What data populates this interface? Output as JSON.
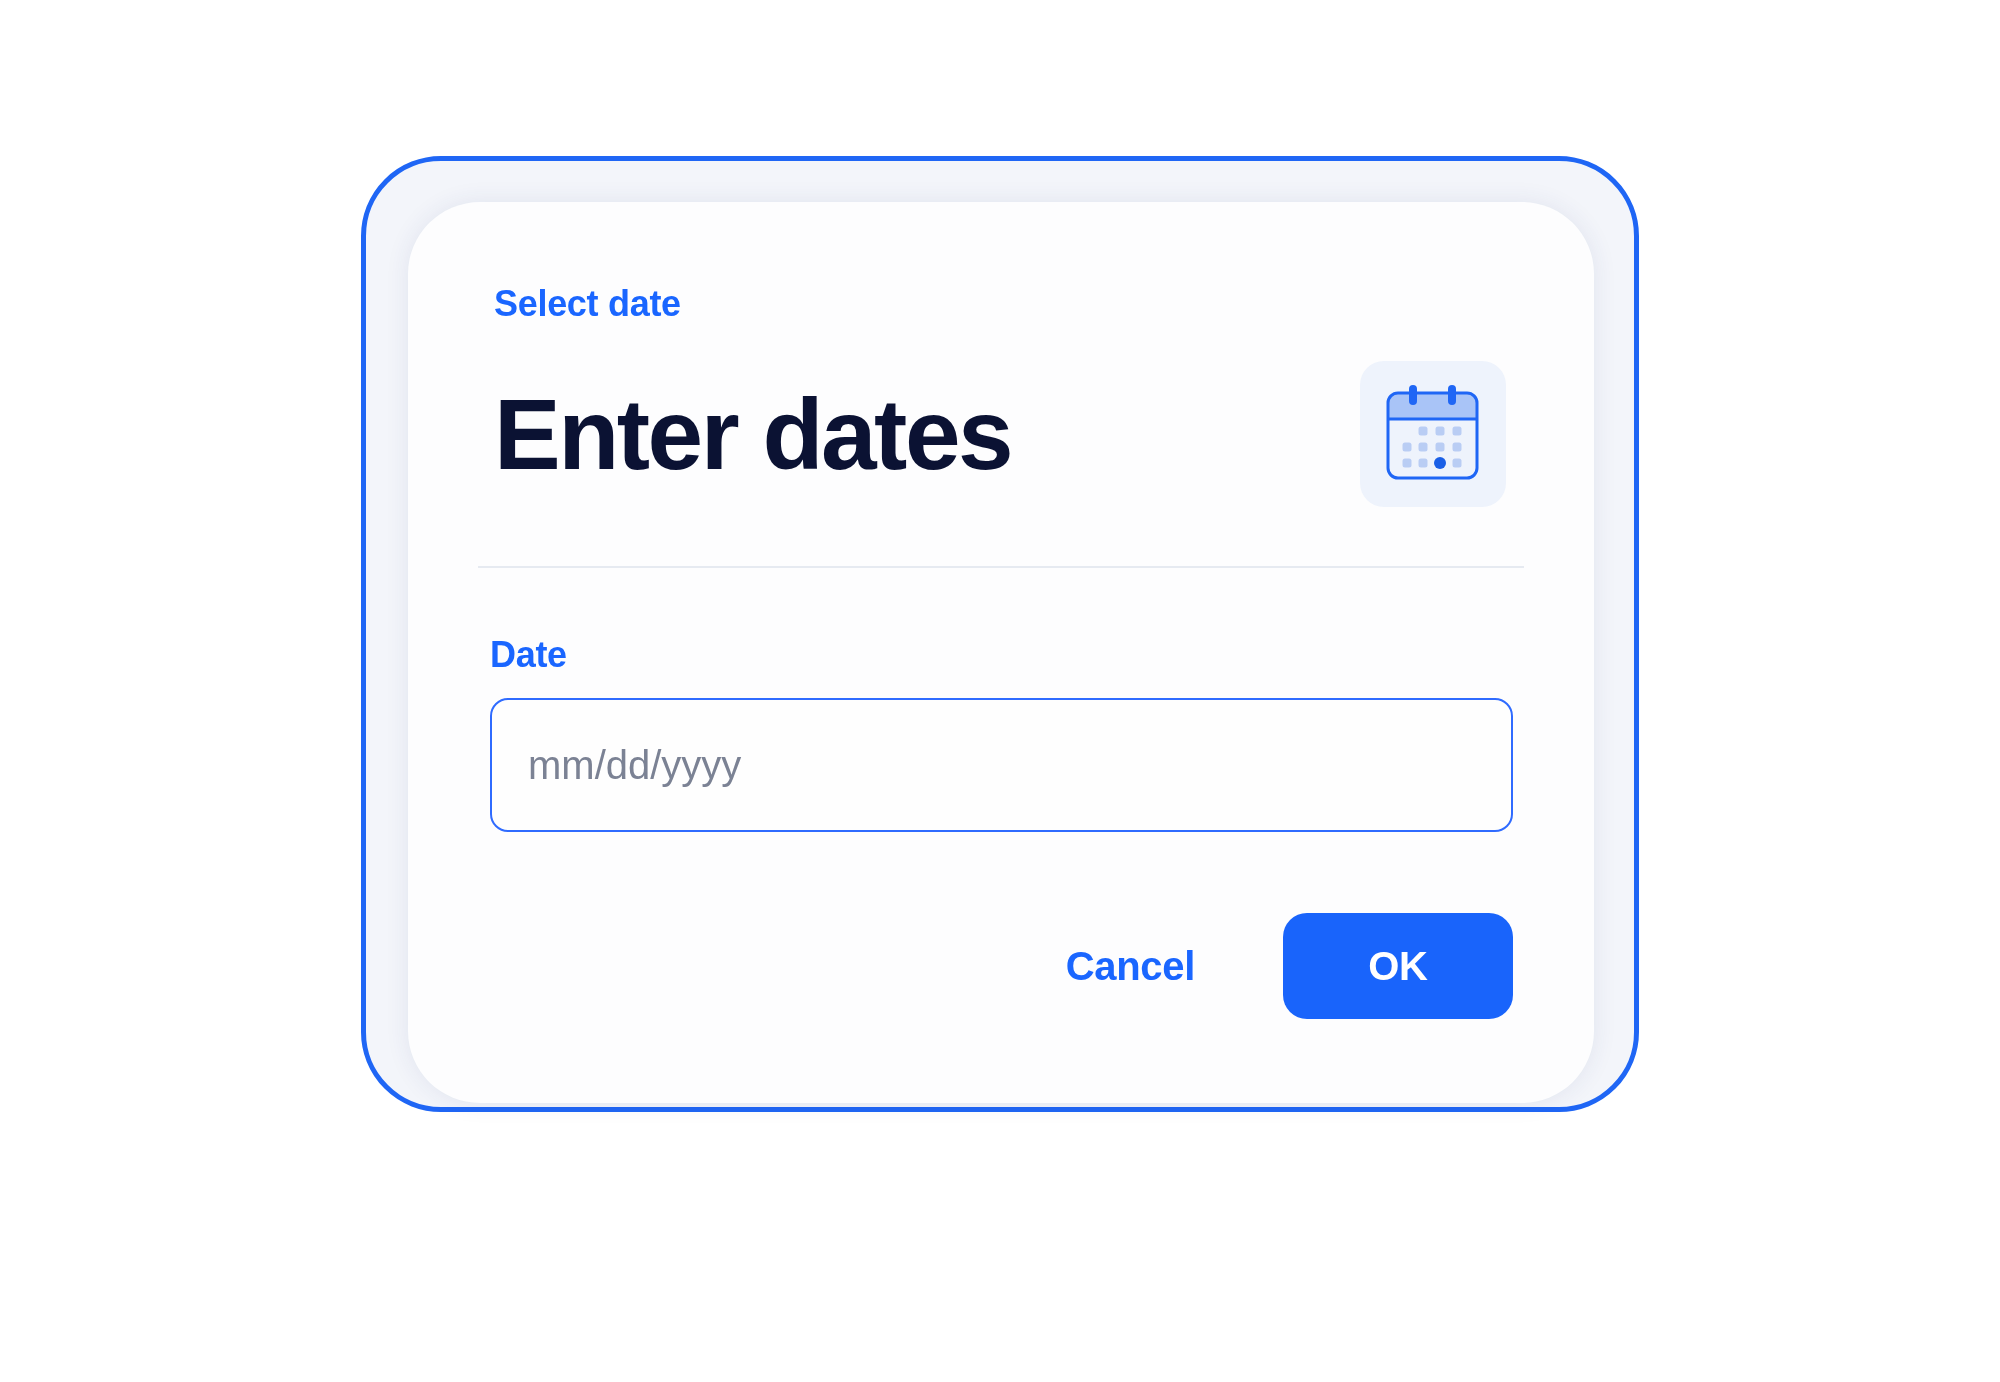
{
  "dialog": {
    "eyebrow": "Select date",
    "title": "Enter dates",
    "field": {
      "label": "Date",
      "placeholder": "mm/dd/yyyy"
    },
    "actions": [
      {
        "label": "Cancel",
        "kind": "text"
      },
      {
        "label": "OK",
        "kind": "filled"
      }
    ]
  }
}
